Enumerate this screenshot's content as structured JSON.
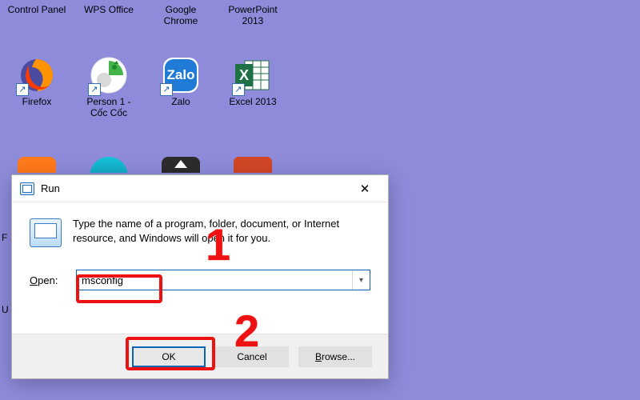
{
  "desktop": {
    "row1": [
      {
        "label": "Control Panel"
      },
      {
        "label": "WPS Office"
      },
      {
        "label": "Google\nChrome"
      },
      {
        "label": "PowerPoint\n2013"
      }
    ],
    "row2": [
      {
        "label": "Firefox"
      },
      {
        "label": "Person 1 -\nCốc Cốc"
      },
      {
        "label": "Zalo"
      },
      {
        "label": "Excel 2013"
      }
    ],
    "edge_labels": [
      "F",
      "U"
    ]
  },
  "run_dialog": {
    "title": "Run",
    "instruction": "Type the name of a program, folder, document, or Internet resource, and Windows will open it for you.",
    "open_label_html": "Open:",
    "open_underline_key": "O",
    "input_value": "msconfig",
    "input_placeholder": "",
    "buttons": {
      "ok": "OK",
      "cancel": "Cancel",
      "browse": "Browse...",
      "browse_underline_key": "B"
    },
    "close_symbol": "✕"
  },
  "annotations": {
    "num1": "1",
    "num2": "2"
  }
}
